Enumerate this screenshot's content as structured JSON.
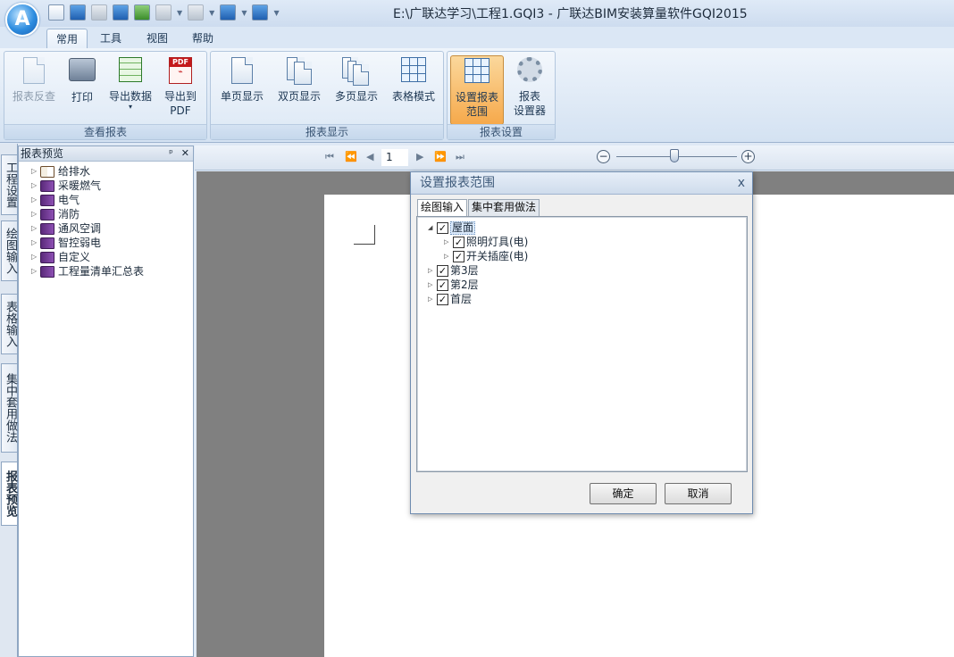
{
  "app": {
    "title": "E:\\广联达学习\\工程1.GQI3 - 广联达BIM安装算量软件GQI2015",
    "orb_letter": "A"
  },
  "ribbon_tabs": [
    "常用",
    "工具",
    "视图",
    "帮助"
  ],
  "ribbon": {
    "groups": [
      {
        "label": "查看报表",
        "buttons": [
          "报表反查",
          "打印",
          "导出数据",
          "导出到\nPDF"
        ]
      },
      {
        "label": "报表显示",
        "buttons": [
          "单页显示",
          "双页显示",
          "多页显示",
          "表格模式"
        ]
      },
      {
        "label": "报表设置",
        "buttons": [
          "设置报表\n范围",
          "报表\n设置器"
        ]
      }
    ]
  },
  "left_tabs": [
    "工程设置",
    "绘图输入",
    "表格输入",
    "集中套用做法",
    "报表预览"
  ],
  "preview_panel": {
    "title": "报表预览",
    "pin_icon": "ᵖ",
    "close_icon": "✕",
    "items": [
      "给排水",
      "采暖燃气",
      "电气",
      "消防",
      "通风空调",
      "智控弱电",
      "自定义",
      "工程量清单汇总表"
    ]
  },
  "preview_toolbar": {
    "page_number": "1",
    "zoom_level": 0.48
  },
  "dialog": {
    "title": "设置报表范围",
    "close": "x",
    "tabs": [
      "绘图输入",
      "集中套用做法"
    ],
    "tree": [
      {
        "label": "屋面",
        "checked": true,
        "children": [
          "照明灯具(电)",
          "开关插座(电)"
        ]
      },
      {
        "label": "第3层",
        "checked": true
      },
      {
        "label": "第2层",
        "checked": true
      },
      {
        "label": "首层",
        "checked": true
      }
    ],
    "ok_label": "确定",
    "cancel_label": "取消",
    "check_mark": "✓"
  },
  "colors": {
    "ribbon_active_button": "#f6a94b",
    "canvas_gray": "#808080"
  }
}
